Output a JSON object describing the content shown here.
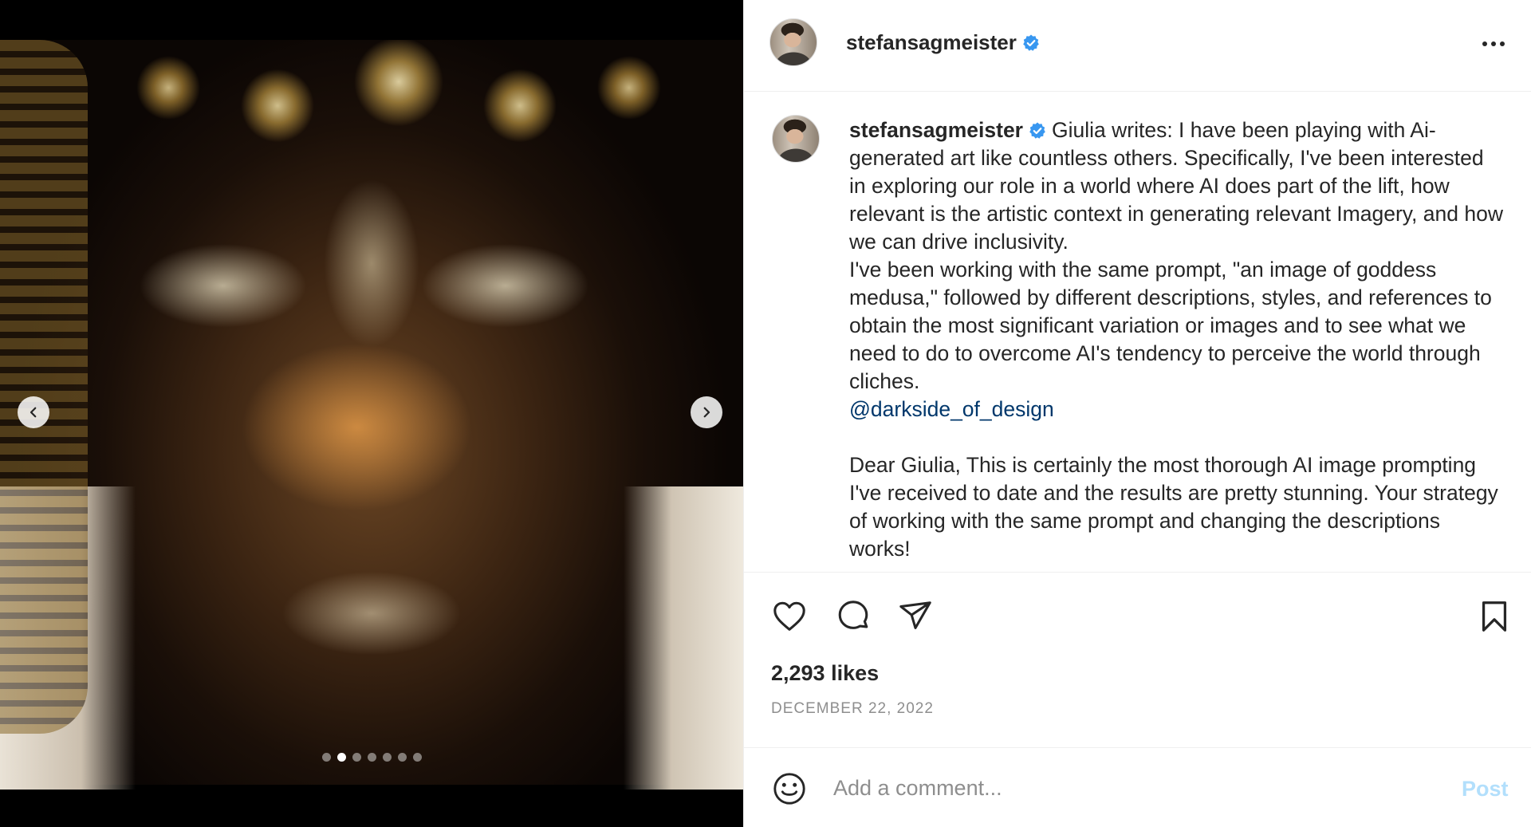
{
  "post": {
    "username": "stefansagmeister",
    "verified": true,
    "more_icon": "more-horizontal-icon"
  },
  "media": {
    "carousel_count": 7,
    "active_index": 1,
    "prev_icon": "chevron-left-icon",
    "next_icon": "chevron-right-icon"
  },
  "caption": {
    "username": "stefansagmeister",
    "paragraph1": "Giulia writes: I have been playing with Ai-generated art like countless others. Specifically, I've been interested in exploring our role in a world where AI does part of the lift, how relevant is the artistic context in generating relevant Imagery, and how we can drive inclusivity.",
    "paragraph2": "I've been working with the same prompt, \"an image of goddess medusa,\" followed by different descriptions, styles, and references to obtain the most significant variation or images and to see what we need to do to overcome AI's tendency to perceive the world through cliches.",
    "mention": "@darkside_of_design",
    "reply": "Dear Giulia, This is certainly the most thorough AI image prompting I've received to date and the results are pretty stunning. Your strategy of working with the same prompt and changing the descriptions works!"
  },
  "actions": {
    "like_icon": "heart-icon",
    "comment_icon": "comment-icon",
    "share_icon": "paper-plane-icon",
    "save_icon": "bookmark-icon",
    "likes": "2,293 likes",
    "date": "DECEMBER 22, 2022"
  },
  "comment_bar": {
    "emoji_icon": "smiley-icon",
    "placeholder": "Add a comment...",
    "post_label": "Post"
  },
  "colors": {
    "verified": "#3897f0",
    "mention": "#00376b",
    "post_disabled": "#b2dffc",
    "muted": "#8e8e8e"
  }
}
